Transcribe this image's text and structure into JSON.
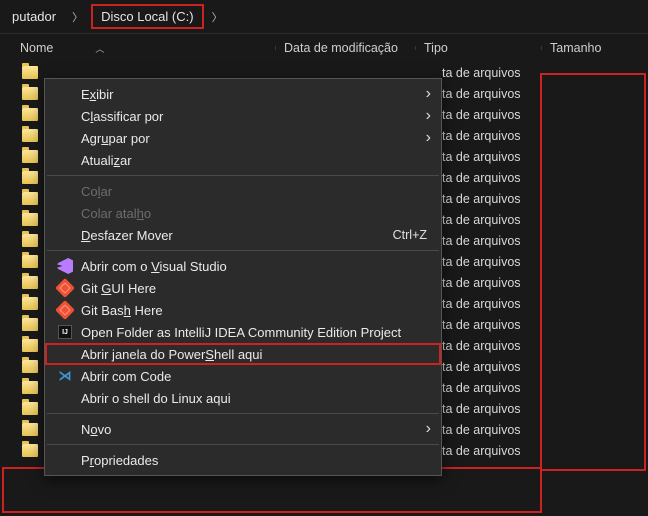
{
  "breadcrumb": {
    "item0": "putador",
    "item1": "Disco Local (C:)"
  },
  "columns": {
    "name": "Nome",
    "date": "Data de modificação",
    "type": "Tipo",
    "size": "Tamanho"
  },
  "type_label": "ta de arquivos",
  "shortcut_undo": "Ctrl+Z",
  "menu": {
    "exibir": "Exibir",
    "classificar": "Classificar por",
    "agrupar": "Agrupar por",
    "atualizar": "Atualizar",
    "colar": "Colar",
    "colar_atalho": "Colar atalho",
    "desfazer": "Desfazer Mover",
    "abrir_vs": "Abrir com o Visual Studio",
    "git_gui": "Git GUI Here",
    "git_bash": "Git Bash Here",
    "intellij": "Open Folder as IntelliJ IDEA Community Edition Project",
    "powershell": "Abrir janela do PowerShell aqui",
    "code": "Abrir com Code",
    "linux": "Abrir o shell do Linux aqui",
    "novo": "Novo",
    "props": "Propriedades"
  },
  "accel": {
    "exibir_pre": "E",
    "exibir_ul": "x",
    "exibir_post": "ibir",
    "class_pre": "C",
    "class_ul": "l",
    "class_post": "assificar por",
    "agr_pre": "Agr",
    "agr_ul": "u",
    "agr_post": "par por",
    "atu_pre": "Atuali",
    "atu_ul": "z",
    "atu_post": "ar",
    "colar_pre": "Co",
    "colar_ul": "l",
    "colar_post": "ar",
    "colat_pre": "Colar atal",
    "colat_ul": "h",
    "colat_post": "o",
    "desf_pre": "",
    "desf_ul": "D",
    "desf_post": "esfazer Mover",
    "vs_pre": "Abrir com o ",
    "vs_ul": "V",
    "vs_post": "isual Studio",
    "gui_pre": "Git ",
    "gui_ul": "G",
    "gui_post": "UI Here",
    "bash_pre": "Git Bas",
    "bash_ul": "h",
    "bash_post": " Here",
    "ps_pre": "Abrir janela do Power",
    "ps_ul": "S",
    "ps_post": "hell aqui",
    "novo_pre": "N",
    "novo_ul": "o",
    "novo_post": "vo",
    "prop_pre": "P",
    "prop_ul": "r",
    "prop_post": "opriedades"
  }
}
